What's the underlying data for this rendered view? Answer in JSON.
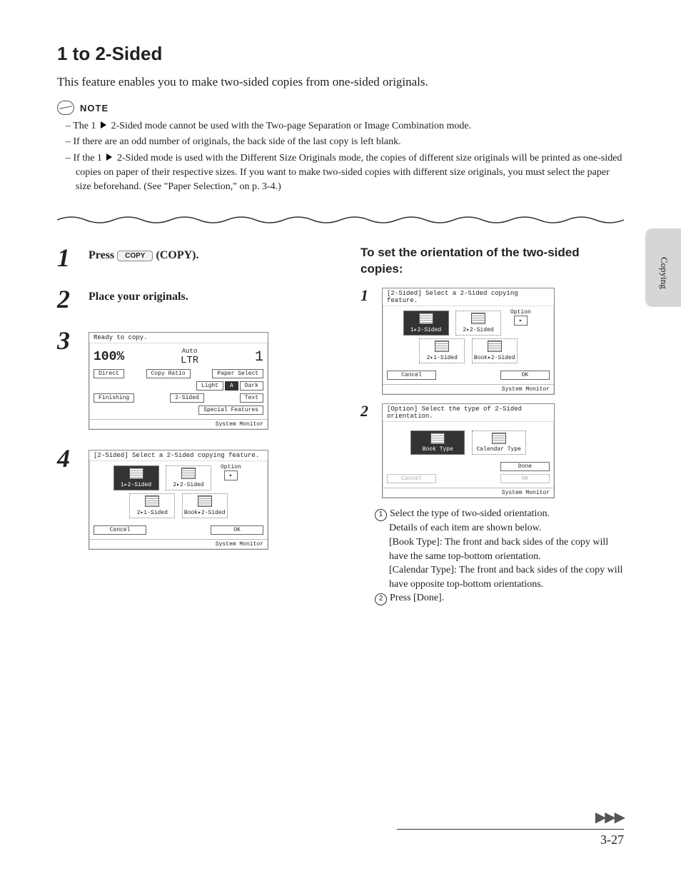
{
  "sideTab": "Copying",
  "title": "1 to 2-Sided",
  "intro": "This feature enables you to make two-sided copies from one-sided originals.",
  "noteLabel": "NOTE",
  "notes": {
    "n1a": "The 1 ",
    "n1b": " 2-Sided mode cannot be used with the Two-page Separation or Image Combination mode.",
    "n2": "If there are an odd number of originals, the back side of the last copy is left blank.",
    "n3a": "If the 1 ",
    "n3b": " 2-Sided mode is used with the Different Size Originals mode, the copies of different size originals will be printed as one-sided copies on paper of their respective sizes. If you want to make two-sided copies with different size originals, you must select the paper size beforehand. (See \"Paper Selection,\" on p. 3-4.)"
  },
  "steps": {
    "s1a": "Press ",
    "s1key": "COPY",
    "s1b": " (COPY).",
    "s2": "Place your originals."
  },
  "screenReady": {
    "title": "Ready to copy.",
    "zoom": "100%",
    "auto": "Auto",
    "ltr": "LTR",
    "qty": "1",
    "direct": "Direct",
    "copyRatio": "Copy Ratio",
    "paperSelect": "Paper Select",
    "light": "Light",
    "a": "A",
    "dark": "Dark",
    "finishing": "Finishing",
    "twoSided": "2-Sided",
    "text": "Text",
    "special": "Special Features",
    "sysmon": "System Monitor"
  },
  "screen2Sided": {
    "title": "[2-Sided] Select a 2-Sided copying feature.",
    "b1": "1▸2-Sided",
    "b2": "2▸2-Sided",
    "b3": "2▸1-Sided",
    "b4": "Book▸2-Sided",
    "option": "Option",
    "cancel": "Cancel",
    "ok": "OK",
    "sysmon": "System Monitor"
  },
  "rightHeading": "To set the orientation of the two-sided copies:",
  "screenOption": {
    "title": "[Option] Select the type of 2-Sided orientation.",
    "book": "Book Type",
    "cal": "Calendar Type",
    "cancel": "Cancel",
    "done": "Done",
    "ok": "OK",
    "sysmon": "System Monitor"
  },
  "explain": {
    "e1": "Select the type of two-sided orientation.",
    "e1d": "Details of each item are shown below.",
    "e1b": "[Book Type]: The front and back sides of the copy will have the same top-bottom orientation.",
    "e1c": "[Calendar Type]: The front and back sides of the copy will have opposite top-bottom orientations.",
    "e2": "Press [Done]."
  },
  "pageNumber": "3-27"
}
